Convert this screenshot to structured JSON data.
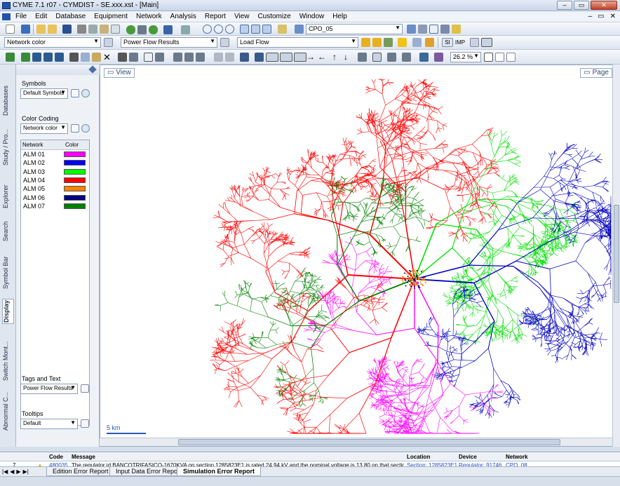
{
  "window": {
    "title": "CYME 7.1 r07 - CYMDIST - SE.xxx.xst - [Main]"
  },
  "menu": {
    "items": [
      "File",
      "Edit",
      "Database",
      "Equipment",
      "Network",
      "Analysis",
      "Report",
      "View",
      "Customize",
      "Window",
      "Help"
    ]
  },
  "toolbar": {
    "study_combo": "CPO_05",
    "color_combo": "Network color",
    "results_combo": "Power Flow Results",
    "analysis_combo": "Load Flow",
    "si_label": "SI",
    "imp_label": "IMP",
    "zoom_combo": "26.2 %"
  },
  "side_tabs": [
    "Databases",
    "Study / Pro...",
    "Explorer",
    "Search",
    "Symbol Bar",
    "Display",
    "Switch Mont...",
    "Abnormal C..."
  ],
  "panel": {
    "symbols_label": "Symbols",
    "symbols_value": "Default Symbols",
    "color_coding_label": "Color Coding",
    "color_coding_value": "Network color",
    "table_headers": [
      "Network",
      "Color"
    ],
    "networks": [
      {
        "name": "ALM 01",
        "color": "#ff00ff"
      },
      {
        "name": "ALM 02",
        "color": "#0000ff"
      },
      {
        "name": "ALM 03",
        "color": "#00ff00"
      },
      {
        "name": "ALM 04",
        "color": "#ff0000"
      },
      {
        "name": "ALM 05",
        "color": "#ff8000"
      },
      {
        "name": "ALM 06",
        "color": "#000080"
      },
      {
        "name": "ALM 07",
        "color": "#008000"
      }
    ],
    "tags_label": "Tags and Text",
    "tags_value": "Power Flow Results",
    "tooltips_label": "Tooltips",
    "tooltips_value": "Default"
  },
  "map": {
    "view_label": "View",
    "page_label": "Page",
    "scale_label": "5 km"
  },
  "errors": {
    "headers": [
      "Code",
      "Message",
      "Location",
      "Device",
      "Network"
    ],
    "rows": [
      {
        "num": "7",
        "code": "480035",
        "message": "The regulator id BANCOTRIFASICO-1670KVA on section 1285823E1 is rated 24.94 kV and the nominal voltage is 13.80 on that section.",
        "location": "Section: 1285823E1",
        "device": "Regulator: 91746",
        "network": "CPO_08"
      }
    ],
    "tabs": [
      "Edition Error Report",
      "Input Data Error Report",
      "Simulation Error Report"
    ]
  }
}
